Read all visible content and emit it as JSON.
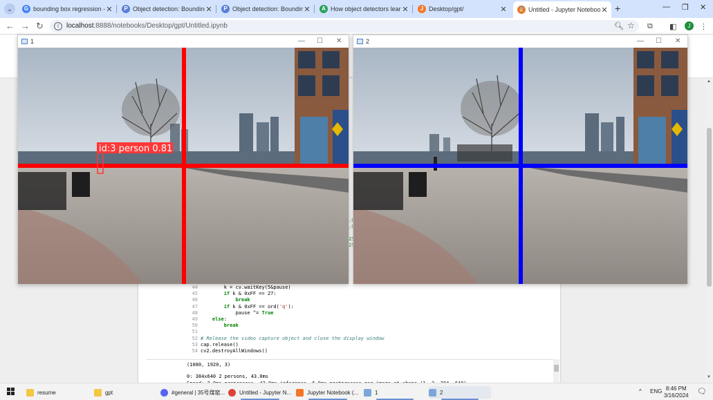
{
  "browser": {
    "tabs": [
      {
        "label": "bounding box regression - Goo",
        "icon": "google-icon",
        "color": "#4285f4",
        "glyph": "G"
      },
      {
        "label": "Object detection: Bounding bo",
        "icon": "pdf-site-icon",
        "color": "#5b7fd6",
        "glyph": "P"
      },
      {
        "label": "Object detection: Bounding bo",
        "icon": "pdf-site-icon",
        "color": "#5b7fd6",
        "glyph": "P"
      },
      {
        "label": "How object detectors learn",
        "icon": "article-site-icon",
        "color": "#2aa15b",
        "glyph": "A"
      },
      {
        "label": "Desktop/gpt/",
        "icon": "jupyter-icon",
        "color": "#f37726",
        "glyph": "J"
      },
      {
        "label": "Untitled - Jupyter Notebook",
        "icon": "jupyter-hourglass-icon",
        "color": "#f37726",
        "glyph": "⌛"
      }
    ],
    "active_tab": 5,
    "url_host": "localhost",
    "url_path": ":8888/notebooks/Desktop/gpt/Untitled.ipynb",
    "profile_initial": "J"
  },
  "windows": {
    "win1": {
      "title": "1",
      "detection_label": "id:3 person 0.81"
    },
    "win2": {
      "title": "2"
    }
  },
  "code": {
    "lines": [
      {
        "n": "44",
        "html": "        k = cv.waitKey(5&pause)"
      },
      {
        "n": "45",
        "html": "        <span class=\"kw\">if</span> k &amp; 0xFF == 27:"
      },
      {
        "n": "46",
        "html": "            <span class=\"kw\">break</span>"
      },
      {
        "n": "47",
        "html": "        <span class=\"kw\">if</span> k &amp; 0xFF == ord(<span class=\"str\">'q'</span>):"
      },
      {
        "n": "48",
        "html": "            pause ^= <span class=\"kw\">True</span>"
      },
      {
        "n": "49",
        "html": "    <span class=\"kw\">else</span>:"
      },
      {
        "n": "50",
        "html": "        <span class=\"kw\">break</span>"
      },
      {
        "n": "51",
        "html": ""
      },
      {
        "n": "52",
        "html": "<span class=\"cm\"># Release the video capture object and close the display window</span>"
      },
      {
        "n": "53",
        "html": "cap.release()"
      },
      {
        "n": "54",
        "html": "cv2.destroyAllWindows()"
      }
    ]
  },
  "output": {
    "line1": "(1080, 1920, 3)",
    "line2": "0: 384x640 2 persons, 43.0ms",
    "line3": "Speed: 2.0ms preprocess, 43.0ms inference, 6.0ms postprocess per image at shape (1, 3, 384, 640)"
  },
  "taskbar": {
    "items": [
      {
        "label": "resume",
        "icon": "folder-icon",
        "color": "#f2c744"
      },
      {
        "label": "gpt",
        "icon": "folder-icon",
        "color": "#f2c744"
      },
      {
        "label": "#general | 35号煤窑...",
        "icon": "discord-icon",
        "color": "#5865f2"
      },
      {
        "label": "Untitled - Jupyter N...",
        "icon": "chrome-icon",
        "color": "#db4437"
      },
      {
        "label": "Jupyter Notebook (...",
        "icon": "jupyter-icon",
        "color": "#f37726"
      },
      {
        "label": "1",
        "icon": "window-icon",
        "color": "#7aa7d8"
      },
      {
        "label": "2",
        "icon": "window-icon",
        "color": "#7aa7d8"
      }
    ],
    "lang": "ENG",
    "time": "8:46 PM",
    "date": "3/16/2024"
  },
  "colors": {
    "win1_line": "#ff0000",
    "win2_line": "#0000ff",
    "label_bg": "#ff3838"
  }
}
